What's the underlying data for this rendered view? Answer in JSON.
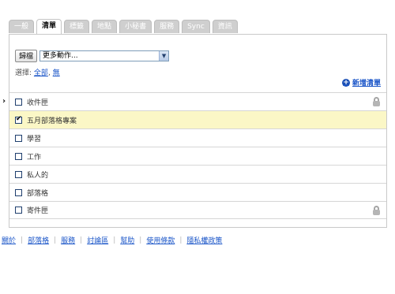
{
  "tabs": [
    {
      "label": "一般",
      "active": false
    },
    {
      "label": "清單",
      "active": true
    },
    {
      "label": "標籤",
      "active": false
    },
    {
      "label": "地點",
      "active": false
    },
    {
      "label": "小秘書",
      "active": false
    },
    {
      "label": "服務",
      "active": false
    },
    {
      "label": "Sync",
      "active": false
    },
    {
      "label": "資訊",
      "active": false
    }
  ],
  "toolbar": {
    "archive_label": "歸檔",
    "more_actions_selected": "更多動作..."
  },
  "select_row": {
    "label": "選擇:",
    "all_label": "全部",
    "separator": ",",
    "none_label": "無"
  },
  "new_list_label": "新增清單",
  "lists": [
    {
      "name": "收件匣",
      "checked": false,
      "current": true,
      "locked": true
    },
    {
      "name": "五月部落格專案",
      "checked": true,
      "current": false,
      "locked": false
    },
    {
      "name": "學習",
      "checked": false,
      "current": false,
      "locked": false
    },
    {
      "name": "工作",
      "checked": false,
      "current": false,
      "locked": false
    },
    {
      "name": "私人的",
      "checked": false,
      "current": false,
      "locked": false
    },
    {
      "name": "部落格",
      "checked": false,
      "current": false,
      "locked": false
    },
    {
      "name": "寄件匣",
      "checked": false,
      "current": false,
      "locked": true
    }
  ],
  "footer_links": [
    "關於",
    "部落格",
    "服務",
    "討論區",
    "幫助",
    "使用條款",
    "隱私權政策"
  ],
  "colors": {
    "link": "#1a55c8",
    "selected_row": "#fbf7c6",
    "tab_inactive": "#cfcfcf"
  }
}
